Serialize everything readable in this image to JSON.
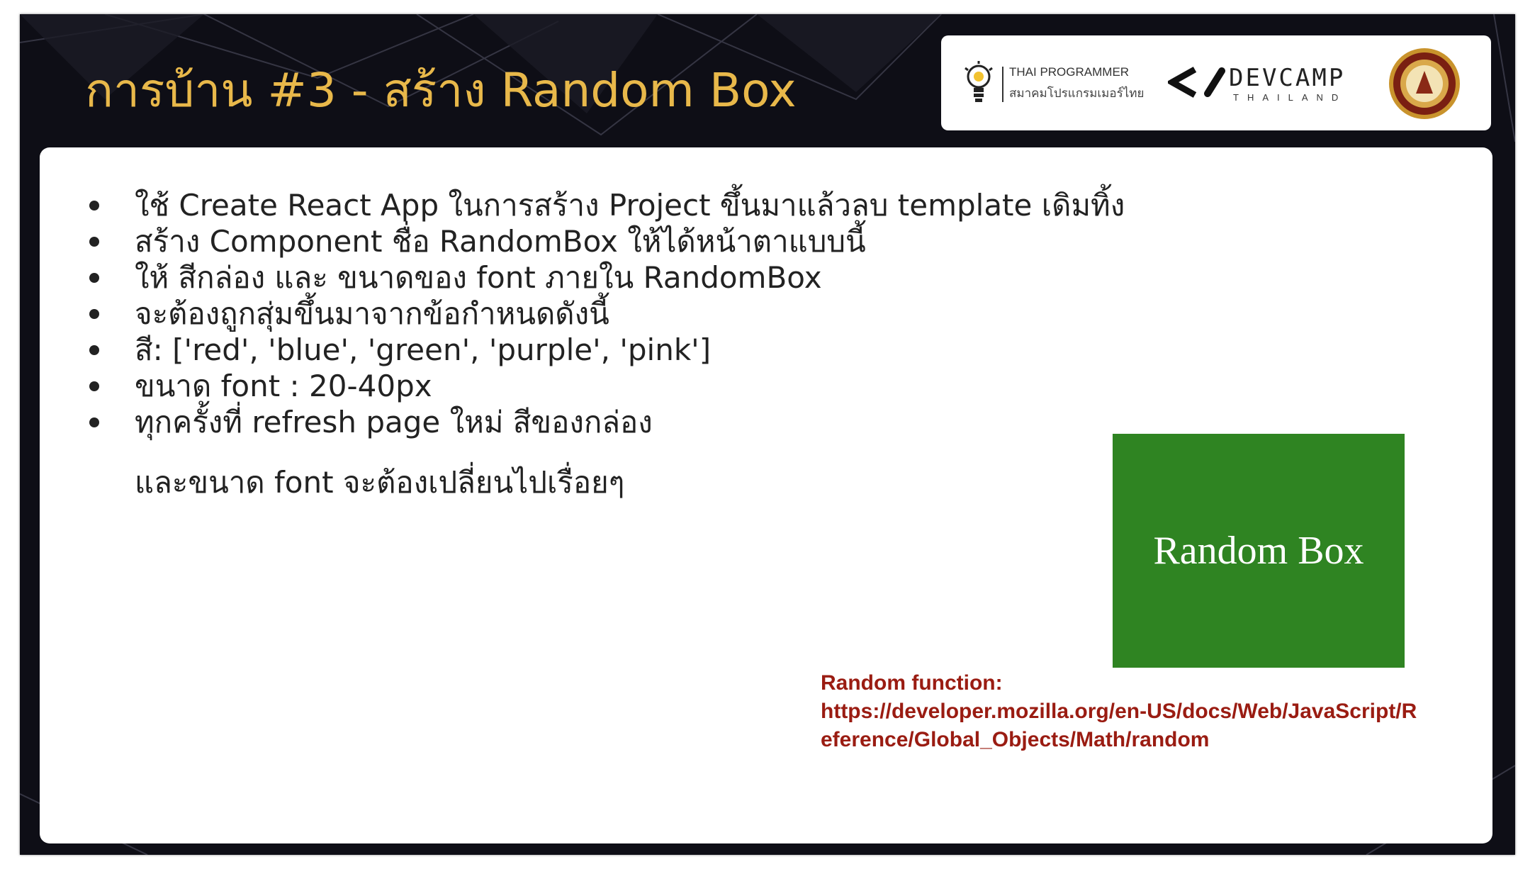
{
  "slide": {
    "title": "การบ้าน #3 - สร้าง Random Box"
  },
  "logos": {
    "thai_programmer": {
      "name": "THAI PROGRAMMER",
      "subtitle": "สมาคมโปรแกรมเมอร์ไทย",
      "icon": "lightbulb-icon"
    },
    "devcamp": {
      "name": "DEVCAMP",
      "subtitle": "THAILAND",
      "icon": "code-bracket-icon"
    },
    "seal": {
      "icon": "university-seal-icon"
    }
  },
  "bullets": [
    "ใช้ Create React App ในการสร้าง Project ขึ้นมาแล้วลบ template เดิมทิ้ง",
    "สร้าง Component ชื่อ RandomBox ให้ได้หน้าตาแบบนี้",
    "ให้ สีกล่อง และ ขนาดของ font ภายใน RandomBox",
    "จะต้องถูกสุ่มขึ้นมาจากข้อกำหนดดังนี้",
    "สี: ['red', 'blue', 'green', 'purple', 'pink']",
    "ขนาด font : 20-40px",
    "ทุกครั้งที่ refresh page ใหม่ สีของกล่อง"
  ],
  "bullet_continuation": "และขนาด font จะต้องเปลี่ยนไปเรื่อยๆ",
  "random_box": {
    "label": "Random Box",
    "color": "#2f8422"
  },
  "reference": {
    "label": "Random function:",
    "url_line1": "https://developer.mozilla.org/en-US/docs/Web/JavaScript/R",
    "url_line2": "eference/Global_Objects/Math/random"
  },
  "colors": {
    "title": "#e8b84a",
    "background": "#0e0e16",
    "reference_text": "#9a1c12"
  }
}
